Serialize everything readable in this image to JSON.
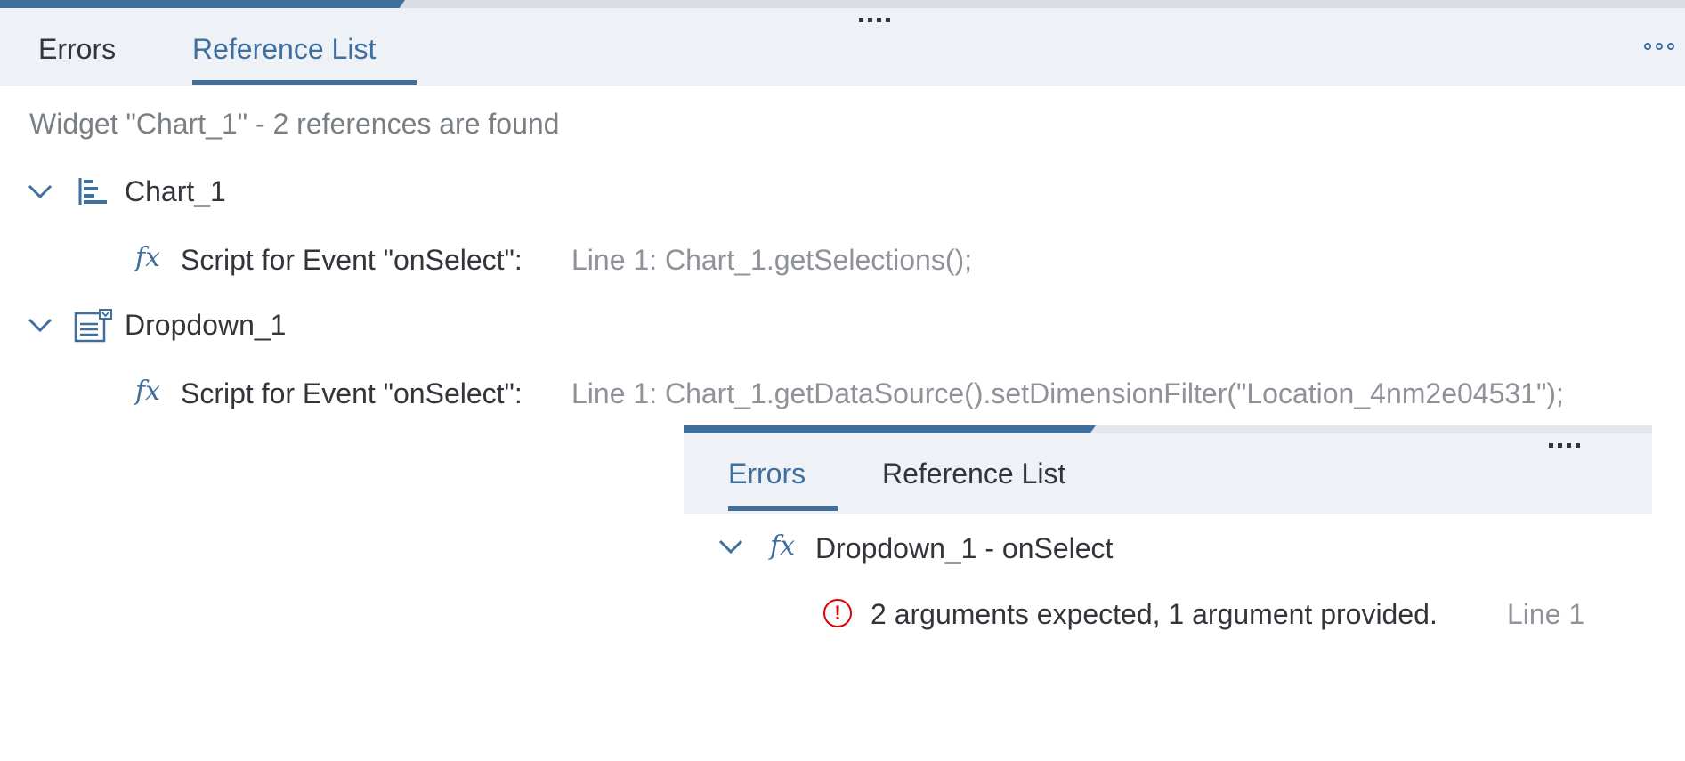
{
  "main": {
    "tabs": [
      {
        "label": "Errors",
        "active": false
      },
      {
        "label": "Reference List",
        "active": true
      }
    ],
    "summary": "Widget \"Chart_1\" - 2 references are found",
    "references": [
      {
        "widget": "Chart_1",
        "icon": "bar-chart-icon",
        "expanded": true,
        "items": [
          {
            "label": "Script for Event \"onSelect\":",
            "detail": "Line 1: Chart_1.getSelections();"
          }
        ]
      },
      {
        "widget": "Dropdown_1",
        "icon": "dropdown-widget-icon",
        "expanded": true,
        "items": [
          {
            "label": "Script for Event \"onSelect\":",
            "detail": "Line 1: Chart_1.getDataSource().setDimensionFilter(\"Location_4nm2e04531\");"
          }
        ]
      }
    ]
  },
  "floating_panel": {
    "tabs": [
      {
        "label": "Errors",
        "active": true
      },
      {
        "label": "Reference List",
        "active": false
      }
    ],
    "groups": [
      {
        "title": "Dropdown_1 - onSelect",
        "icon": "fx-icon",
        "expanded": true,
        "errors": [
          {
            "message": "2 arguments expected, 1 argument provided.",
            "location": "Line 1"
          }
        ]
      }
    ]
  },
  "colors": {
    "accent": "#3f6f9f",
    "tabbar_bg": "#eef2f6",
    "text": "#32363a",
    "muted_text": "#8f9399",
    "error": "#e00000"
  }
}
